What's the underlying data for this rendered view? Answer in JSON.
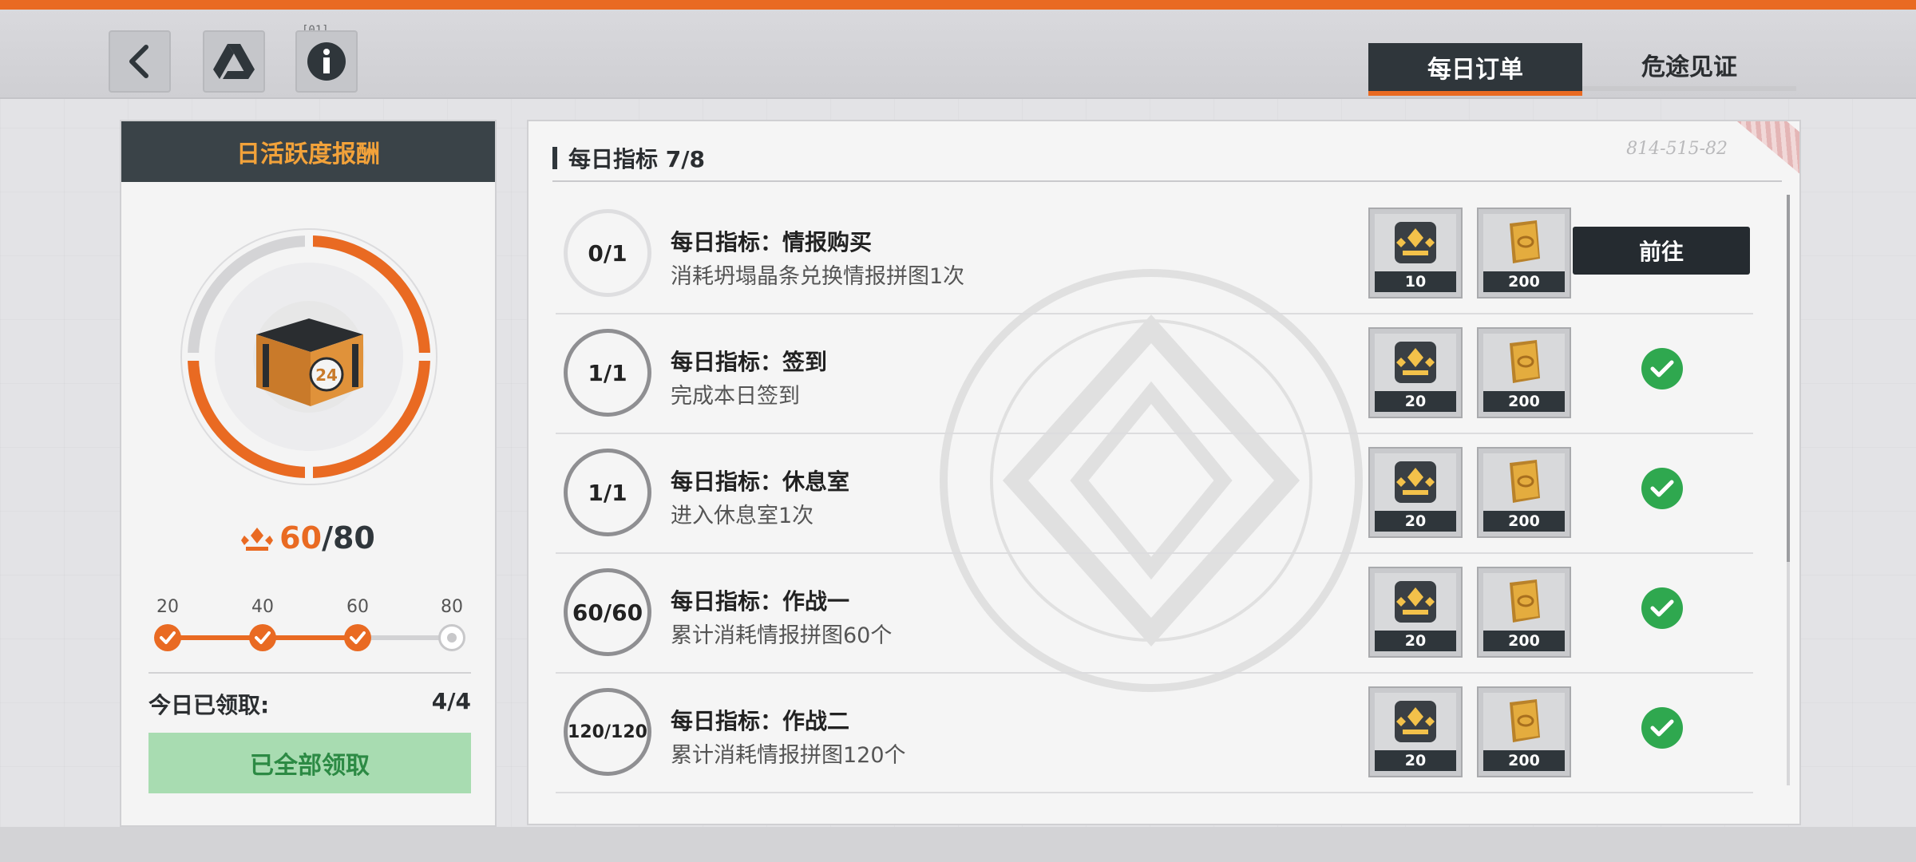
{
  "top": {
    "tag_small": "[01]",
    "tabs": [
      {
        "label": "每日订单",
        "active": true
      },
      {
        "label": "危途见证",
        "active": false
      }
    ]
  },
  "left_panel": {
    "title": "日活跃度报酬",
    "progress_current": "60",
    "progress_max": "/80",
    "progress_fraction": 0.75,
    "milestones": [
      {
        "label": "20",
        "done": true
      },
      {
        "label": "40",
        "done": true
      },
      {
        "label": "60",
        "done": true
      },
      {
        "label": "80",
        "done": false
      }
    ],
    "claimed_label": "今日已领取:",
    "claimed_value": "4/4",
    "claim_all_button": "已全部领取",
    "chest_badge": "24"
  },
  "right_panel": {
    "header": "每日指标 7/8",
    "code": "814-515-82",
    "goto_label": "前往",
    "tasks": [
      {
        "progress": "0/1",
        "title": "每日指标：情报购买",
        "desc": "消耗坍塌晶条兑换情报拼图1次",
        "reward1": "10",
        "reward2": "200",
        "status": "goto"
      },
      {
        "progress": "1/1",
        "title": "每日指标：签到",
        "desc": "完成本日签到",
        "reward1": "20",
        "reward2": "200",
        "status": "done"
      },
      {
        "progress": "1/1",
        "title": "每日指标：休息室",
        "desc": "进入休息室1次",
        "reward1": "20",
        "reward2": "200",
        "status": "done"
      },
      {
        "progress": "60/60",
        "title": "每日指标：作战一",
        "desc": "累计消耗情报拼图60个",
        "reward1": "20",
        "reward2": "200",
        "status": "done"
      },
      {
        "progress": "120/120",
        "title": "每日指标：作战二",
        "desc": "累计消耗情报拼图120个",
        "reward1": "20",
        "reward2": "200",
        "status": "done"
      }
    ]
  },
  "colors": {
    "accent": "#e96a22",
    "dark": "#2f363b",
    "success": "#2fa84f",
    "claimed_bg": "#a8dcb1",
    "claimed_text": "#2c8a44"
  },
  "icons": {
    "back": "chevron-left-icon",
    "drive": "drive-icon",
    "info": "info-icon",
    "activity": "activity-icon",
    "gold": "gold-bar-icon",
    "check": "check-icon"
  }
}
